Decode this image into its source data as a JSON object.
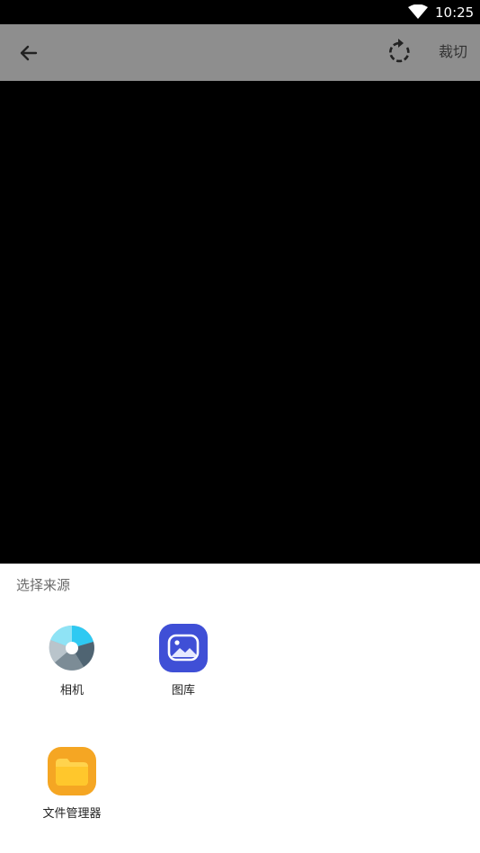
{
  "status_bar": {
    "time": "10:25",
    "wifi_icon": "wifi-icon"
  },
  "toolbar": {
    "back_icon": "arrow-left-icon",
    "rotate_icon": "rotate-icon",
    "crop_label": "裁切"
  },
  "colors": {
    "toolbar_bg": "#8e8e8e",
    "preview_bg": "#000000",
    "sheet_bg": "#ffffff"
  },
  "source_sheet": {
    "title": "选择来源",
    "options": [
      {
        "label": "相机",
        "icon": "camera-app-icon"
      },
      {
        "label": "图库",
        "icon": "gallery-app-icon"
      },
      {
        "label": "文件管理器",
        "icon": "file-manager-app-icon"
      }
    ]
  }
}
